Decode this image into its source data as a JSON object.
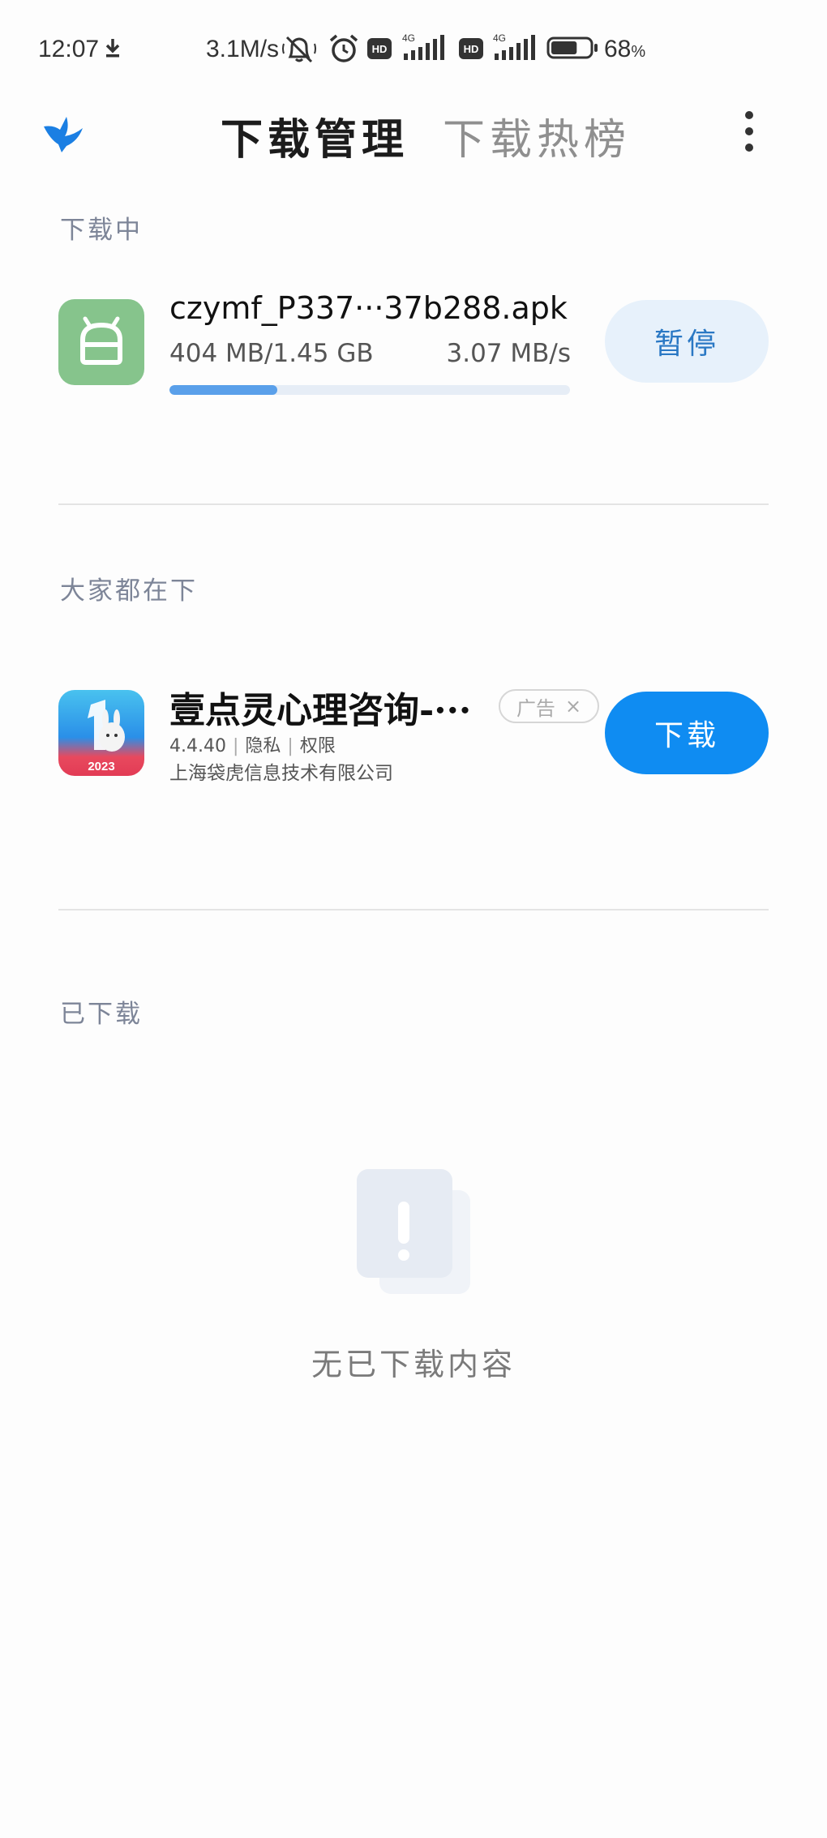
{
  "status_bar": {
    "time": "12:07",
    "speed": "3.1M/s",
    "network": "4G",
    "hd": "HD",
    "battery_value": "68",
    "battery_unit": "%",
    "battery_level": 0.68
  },
  "header": {
    "tab_active": "下载管理",
    "tab_inactive": "下载热榜",
    "icons": {
      "logo": "bird-logo-icon",
      "more": "more-vertical-icon"
    }
  },
  "downloading": {
    "section_title": "下载中",
    "item": {
      "file_name": "czymf_P337···37b288.apk",
      "size": "404 MB/1.45 GB",
      "speed": "3.07 MB/s",
      "progress": 0.27,
      "button": "暂停"
    }
  },
  "popular": {
    "section_title": "大家都在下",
    "item": {
      "name": "壹点灵心理咨询-···",
      "ad_label": "广告",
      "ad_close": "×",
      "version": "4.4.40",
      "privacy": "隐私",
      "permissions": "权限",
      "separator": "|",
      "company": "上海袋虎信息技术有限公司",
      "icon_year": "2023",
      "button": "下载"
    }
  },
  "downloaded": {
    "section_title": "已下载",
    "empty_text": "无已下载内容"
  },
  "colors": {
    "accent": "#0f8cf2",
    "pause_bg": "#e7f1fb",
    "progress": "#5aa0ea",
    "android_icon": "#86c48c"
  }
}
